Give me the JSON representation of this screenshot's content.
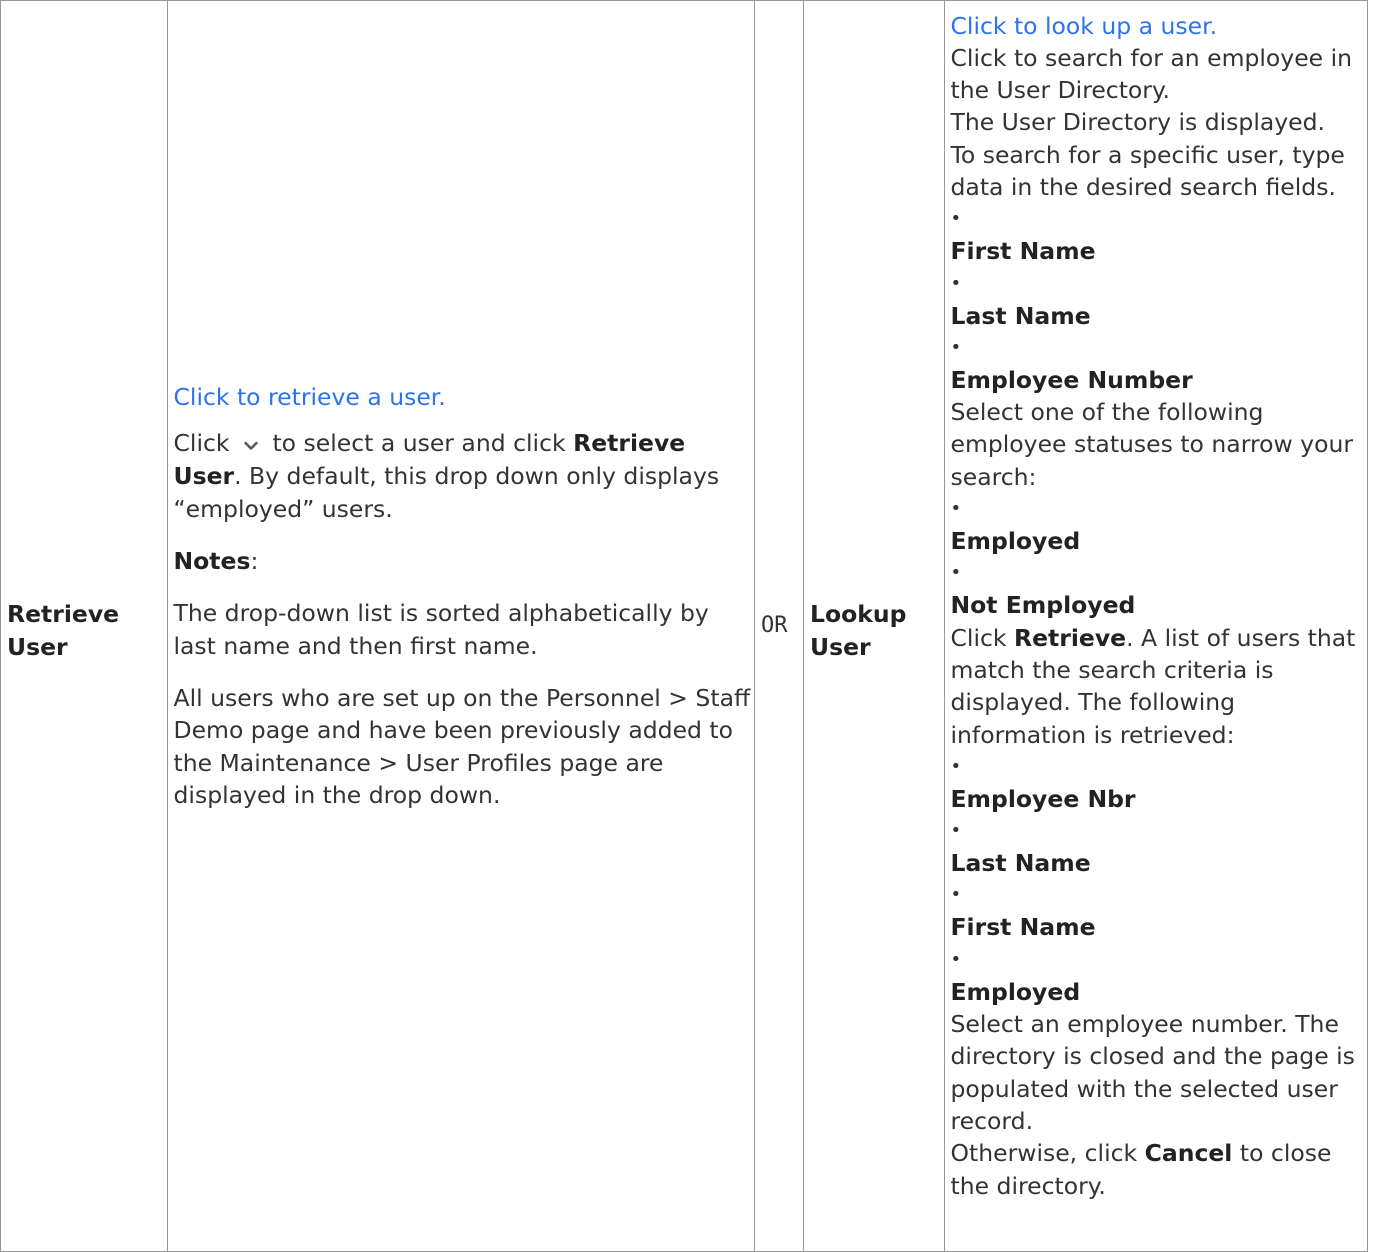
{
  "retrieve": {
    "heading": "Retrieve User",
    "link": "Click to retrieve a user.",
    "click_prefix": "Click",
    "click_suffix": "to select a user and click",
    "button_bold": "Retrieve User",
    "by_default": ". By default, this drop down only displays “employed” users.",
    "notes_label": "Notes",
    "notes_colon": ":",
    "note1": "The drop-down list is sorted alphabetically by last name and then first name.",
    "note2": "All users who are set up on the Personnel > Staff Demo page and have been previously added to the Maintenance > User Profiles page are displayed in the drop down."
  },
  "or_label": "OR",
  "lookup": {
    "heading": "Lookup User",
    "link": "Click to look up a user.",
    "intro": "Click to search for an employee in the User Directory.",
    "displayed": "The User Directory is displayed.",
    "search_hint": "To search for a specific user, type data in the desired search fields.",
    "search_fields": [
      "First Name",
      "Last Name",
      "Employee Number"
    ],
    "status_hint": "Select one of the following employee statuses to narrow your search:",
    "statuses": [
      "Employed",
      "Not Employed"
    ],
    "retrieve_prefix": "Click",
    "retrieve_bold": "Retrieve",
    "retrieve_suffix": ". A list of users that match the search criteria is displayed. The following information is retrieved:",
    "result_fields": [
      "Employee Nbr",
      "Last Name",
      "First Name",
      "Employed"
    ],
    "select_text": "Select an employee number. The directory is closed and the page is populated with the selected user record.",
    "otherwise_prefix": "Otherwise, click",
    "cancel_bold": "Cancel",
    "otherwise_suffix": "to close the directory.",
    "bullet_char": "•"
  },
  "icons": {
    "dropdown": "chevron-down-icon"
  },
  "colors": {
    "link": "#2b73f3",
    "border": "#999999"
  }
}
